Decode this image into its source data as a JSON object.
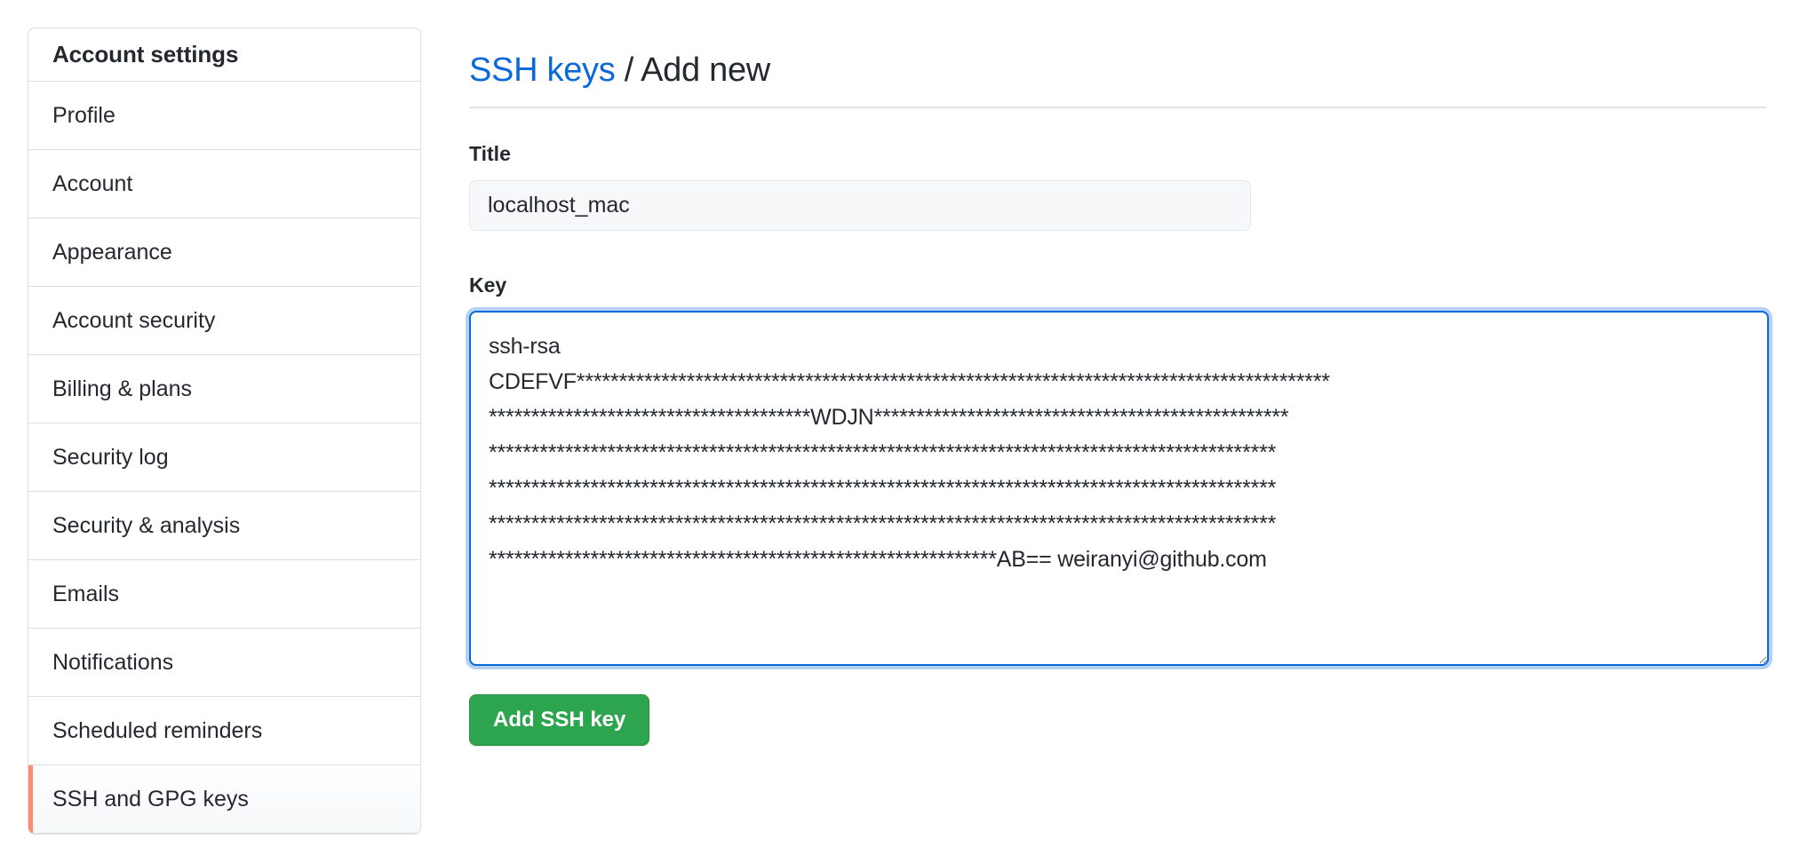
{
  "sidebar": {
    "heading": "Account settings",
    "items": [
      {
        "label": "Profile",
        "selected": false
      },
      {
        "label": "Account",
        "selected": false
      },
      {
        "label": "Appearance",
        "selected": false
      },
      {
        "label": "Account security",
        "selected": false
      },
      {
        "label": "Billing & plans",
        "selected": false
      },
      {
        "label": "Security log",
        "selected": false
      },
      {
        "label": "Security & analysis",
        "selected": false
      },
      {
        "label": "Emails",
        "selected": false
      },
      {
        "label": "Notifications",
        "selected": false
      },
      {
        "label": "Scheduled reminders",
        "selected": false
      },
      {
        "label": "SSH and GPG keys",
        "selected": true
      }
    ],
    "selected_accent_color": "#fd8c73"
  },
  "main": {
    "breadcrumb": {
      "link_label": "SSH keys",
      "separator": "/",
      "current_label": "Add new"
    },
    "title_field": {
      "label": "Title",
      "value": "localhost_mac",
      "placeholder": ""
    },
    "key_field": {
      "label": "Key",
      "placeholder": "",
      "focused": true,
      "value": "ssh-rsa\nCDEFVF*****************************************************************************************\n**************************************WDJN*************************************************\n*********************************************************************************************\n*********************************************************************************************\n*********************************************************************************************\n************************************************************AB== weiranyi@github.com"
    },
    "submit_button": {
      "label": "Add SSH key",
      "color": "#2da44e"
    }
  }
}
